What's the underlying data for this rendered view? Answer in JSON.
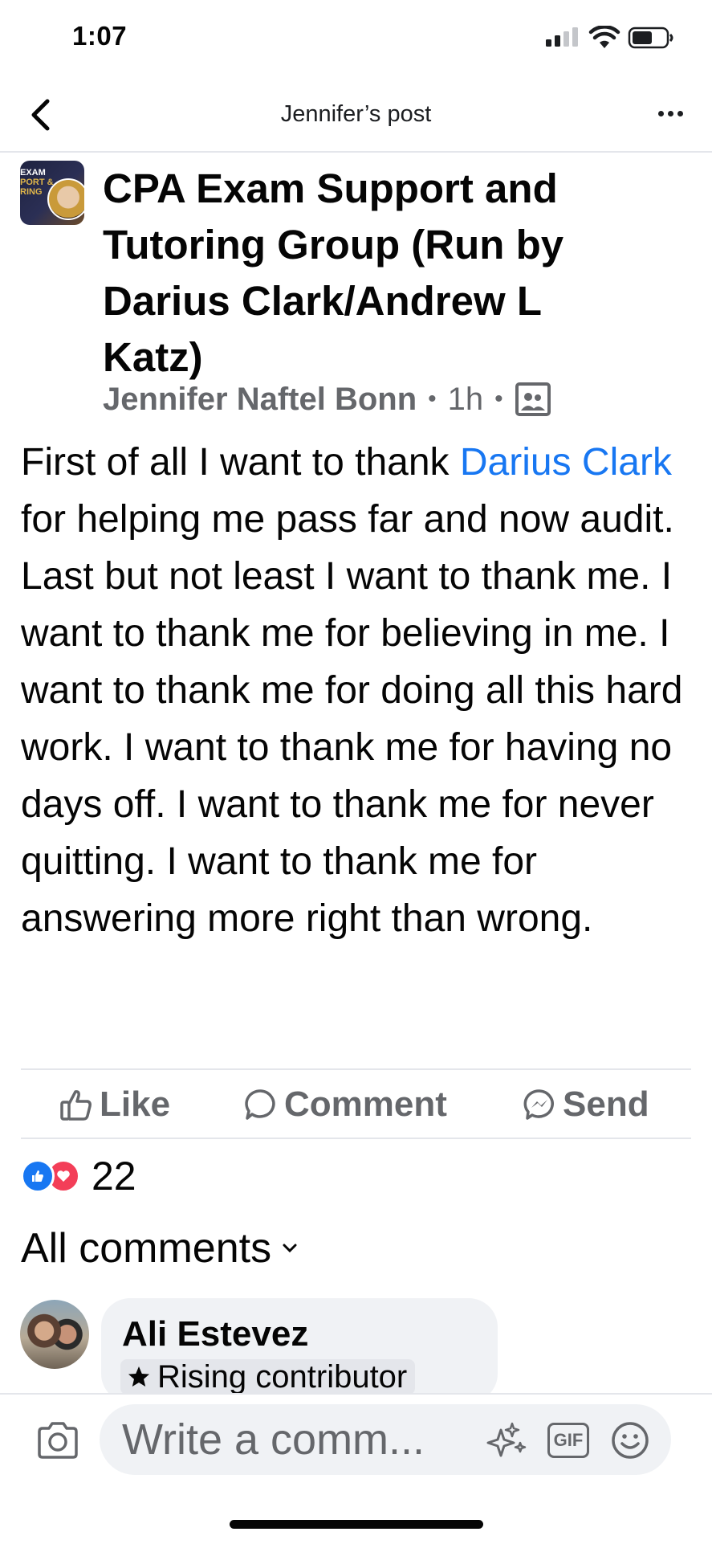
{
  "status_bar": {
    "time": "1:07"
  },
  "header": {
    "title": "Jennifer’s post"
  },
  "post": {
    "group_name": "CPA Exam Support and Tutoring Group (Run by Darius Clark/Andrew L Katz)",
    "group_avatar_text": [
      "EXAM",
      "PORT &",
      "RING"
    ],
    "author": "Jennifer Naftel Bonn",
    "time_ago": "1h",
    "text_before_mention": "First of all I want to thank ",
    "mention": "Darius Clark",
    "text_after_mention": " for helping me pass far and now audit. Last but not least I want to thank me. I want to thank me for believing in me. I want to thank me for doing all this hard work. I want to thank me for having no days off. I want to thank me for never quitting. I want to thank me for answering more right than wrong."
  },
  "actions": {
    "like": "Like",
    "comment": "Comment",
    "send": "Send"
  },
  "reactions": {
    "count": "22"
  },
  "comments": {
    "filter_label": "All comments",
    "items": [
      {
        "name": "Ali Estevez",
        "badge": "Rising contributor"
      }
    ]
  },
  "composer": {
    "placeholder": "Write a comm..."
  },
  "colors": {
    "link": "#1877f2",
    "love": "#f33e58",
    "secondary_text": "#65676b"
  }
}
